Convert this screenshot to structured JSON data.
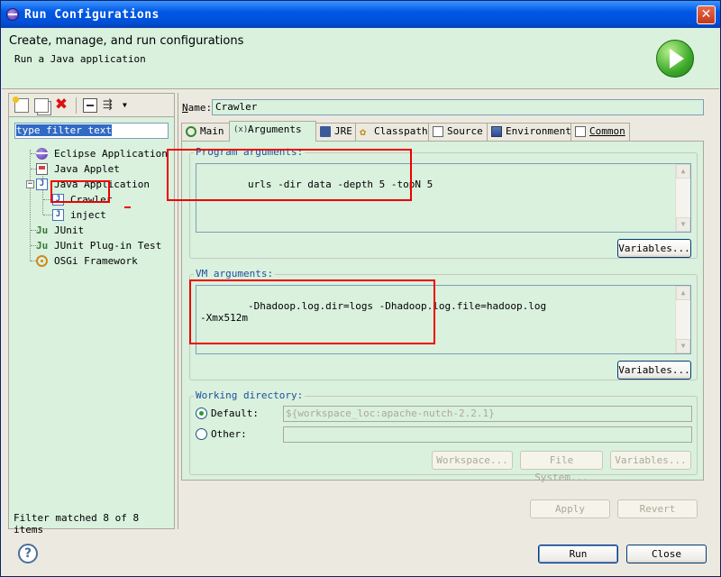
{
  "window": {
    "title": "Run Configurations",
    "close_glyph": "✕"
  },
  "header": {
    "title": "Create, manage, and run configurations",
    "subtitle": "Run a Java application"
  },
  "sidebar": {
    "filter_placeholder": "type filter text",
    "tree": [
      {
        "label": "Eclipse Application",
        "icon": "eclipse-icon"
      },
      {
        "label": "Java Applet",
        "icon": "java-applet-icon"
      },
      {
        "label": "Java Application",
        "icon": "java-app-icon",
        "expanded": true,
        "children": [
          {
            "label": "Crawler",
            "icon": "java-class-icon",
            "selected": true
          },
          {
            "label": "inject",
            "icon": "java-class-icon"
          }
        ]
      },
      {
        "label": "JUnit",
        "icon": "junit-icon"
      },
      {
        "label": "JUnit Plug-in Test",
        "icon": "junit-plugin-icon"
      },
      {
        "label": "OSGi Framework",
        "icon": "osgi-icon"
      }
    ],
    "status": "Filter matched 8 of 8 items"
  },
  "name_field": {
    "label_n": "N",
    "label_rest": "ame:",
    "value": "Crawler"
  },
  "tabs": [
    {
      "label": "Main",
      "active": false
    },
    {
      "label": "Arguments",
      "active": true
    },
    {
      "label": "JRE",
      "active": false
    },
    {
      "label": "Classpath",
      "active": false
    },
    {
      "label": "Source",
      "active": false
    },
    {
      "label": "Environment",
      "active": false
    },
    {
      "label": "Common",
      "active": false
    }
  ],
  "arguments": {
    "program_title": "Program arguments:",
    "program_value": "urls -dir data -depth 5 -topN 5",
    "vm_title": "VM arguments:",
    "vm_value": "-Dhadoop.log.dir=logs -Dhadoop.log.file=hadoop.log\n-Xmx512m",
    "variables_label": "Variables..."
  },
  "working_directory": {
    "title": "Working directory:",
    "default_label": "Default:",
    "default_value": "${workspace_loc:apache-nutch-2.2.1}",
    "other_label": "Other:",
    "workspace_btn": "Workspace...",
    "filesystem_btn": "File System...",
    "variables_btn": "Variables..."
  },
  "actions": {
    "apply": "Apply",
    "revert": "Revert",
    "run": "Run",
    "close": "Close"
  },
  "colors": {
    "panel_bg": "#d9f1dd",
    "title_blue": "#0058e6",
    "annotation_red": "#e00000"
  }
}
